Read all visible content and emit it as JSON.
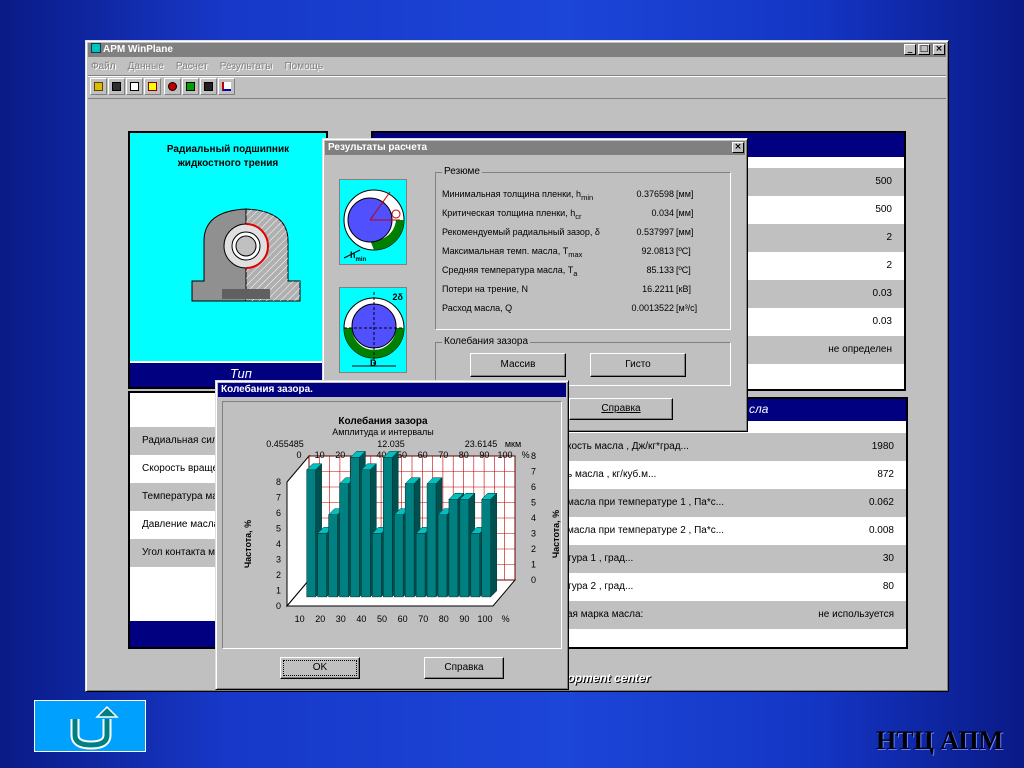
{
  "app": {
    "title": "APM WinPlane",
    "menu": [
      "Файл",
      "Данные",
      "Расчет",
      "Результаты",
      "Помощь"
    ],
    "toolbar_icons": [
      "open-icon",
      "save-icon",
      "print-icon",
      "printer-setup-icon",
      "compute-icon",
      "wizard-icon",
      "calculator-icon",
      "chart-icon"
    ],
    "window_controls": [
      "_",
      "□",
      "×"
    ]
  },
  "left_panel": {
    "title_line1": "Радиальный подшипник",
    "title_line2": "жидкостного трения",
    "type_label": "Тип"
  },
  "right_table_top": {
    "values": [
      "500",
      "500",
      "2",
      "2",
      "0.03",
      "0.03",
      "не определен"
    ]
  },
  "left_table": {
    "labels": [
      "Радиальная сила",
      "Скорость вращен",
      "Температура масл",
      "Давление масла",
      "Угол контакта ма"
    ]
  },
  "right_table_bottom": {
    "header": "сла",
    "rows": [
      {
        "label": "кость масла , Дж/кг*град...",
        "value": "1980"
      },
      {
        "label": "ь масла , кг/куб.м...",
        "value": "872"
      },
      {
        "label": "масла при температуре 1 , Па*с...",
        "value": "0.062"
      },
      {
        "label": "масла при температуре 2 , Па*с...",
        "value": "0.008"
      },
      {
        "label": "тура 1 , град...",
        "value": "30"
      },
      {
        "label": "тура 2 , град...",
        "value": "80"
      },
      {
        "label": "ая марка масла:",
        "value": "не используется"
      }
    ]
  },
  "footer_text": "lopment center",
  "results_dialog": {
    "title": "Результаты расчета",
    "resume_label": "Резюме",
    "params": [
      {
        "label": "Минимальная толщина пленки, h",
        "sub": "min",
        "value": "0.376598",
        "unit": "[мм]"
      },
      {
        "label": "Критическая толщина пленки, h",
        "sub": "cr",
        "value": "0.034",
        "unit": "[мм]"
      },
      {
        "label": "Рекомендуемый радиальный зазор, δ",
        "sub": "",
        "value": "0.537997",
        "unit": "[мм]"
      },
      {
        "label": "Максимальная темп. масла, T",
        "sub": "max",
        "value": "92.0813",
        "unit": "[ºC]"
      },
      {
        "label": "Средняя температура масла, T",
        "sub": "a",
        "value": "85.133",
        "unit": "[ºC]"
      },
      {
        "label": "Потери на трение, N",
        "sub": "",
        "value": "16.2211",
        "unit": "[кВ]"
      },
      {
        "label": "Расход масла, Q",
        "sub": "",
        "value": "0.0013522",
        "unit": "[м³/с]"
      }
    ],
    "fluct_label": "Колебания зазора",
    "btn_array": "Массив",
    "btn_histo": "Гисто",
    "btn_help": "Справка",
    "diagram_labels": {
      "hmin": "h",
      "hmin_sub": "min",
      "delta": "2δ",
      "d": "D"
    }
  },
  "histo_dialog": {
    "title": "Колебания зазора.",
    "chart_title": "Колебания зазора",
    "chart_subtitle": "Амплитуда и интервалы",
    "top_values": [
      "0.455485",
      "12.035",
      "23.6145",
      "мкм"
    ],
    "ylabel": "Частота, %",
    "btn_ok": "OK",
    "btn_help": "Справка"
  },
  "chart_data": {
    "type": "bar",
    "title": "Колебания зазора",
    "subtitle": "Амплитуда и интервалы",
    "x_ticks_bottom": [
      "10",
      "20",
      "30",
      "40",
      "50",
      "60",
      "70",
      "80",
      "90",
      "100",
      "%"
    ],
    "x_ticks_top": [
      "0",
      "10",
      "20",
      "30",
      "40",
      "50",
      "60",
      "70",
      "80",
      "90",
      "100",
      "%"
    ],
    "y_ticks": [
      "0",
      "1",
      "2",
      "3",
      "4",
      "5",
      "6",
      "7",
      "8"
    ],
    "ylabel": "Частота, %",
    "values": [
      8.2,
      4.1,
      5.3,
      7.3,
      9.0,
      8.2,
      4.1,
      9.0,
      5.3,
      7.3,
      4.1,
      7.3,
      5.3,
      6.3,
      6.3,
      4.1,
      6.3
    ],
    "ylim": [
      0,
      8
    ]
  },
  "brand": "НТЦ АПМ",
  "colors": {
    "title_active": "#000080",
    "title_inactive": "#808080",
    "cyan": "#00ffff",
    "bar": "#008080",
    "grid": "#c00000"
  }
}
